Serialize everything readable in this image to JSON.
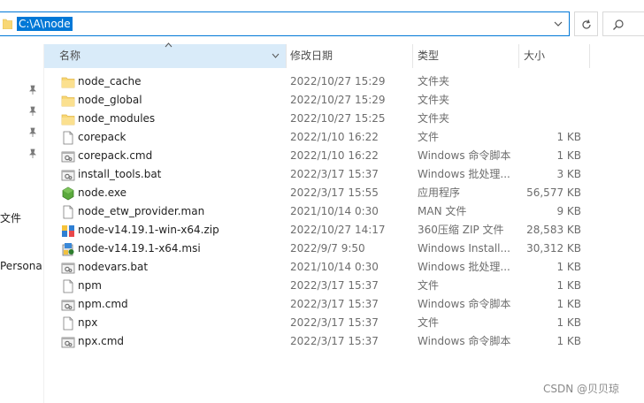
{
  "address": {
    "path": "C:\\A\\node"
  },
  "nav": {
    "partial_labels": [
      "文件",
      "Persona"
    ]
  },
  "columns": {
    "name": "名称",
    "date": "修改日期",
    "type": "类型",
    "size": "大小"
  },
  "files": [
    {
      "name": "node_cache",
      "date": "2022/10/27 15:29",
      "type": "文件夹",
      "size": "",
      "icon": "folder-icon"
    },
    {
      "name": "node_global",
      "date": "2022/10/27 15:29",
      "type": "文件夹",
      "size": "",
      "icon": "folder-icon"
    },
    {
      "name": "node_modules",
      "date": "2022/10/27 15:25",
      "type": "文件夹",
      "size": "",
      "icon": "folder-icon"
    },
    {
      "name": "corepack",
      "date": "2022/1/10 16:22",
      "type": "文件",
      "size": "1 KB",
      "icon": "file-icon"
    },
    {
      "name": "corepack.cmd",
      "date": "2022/1/10 16:22",
      "type": "Windows 命令脚本",
      "size": "1 KB",
      "icon": "script-icon"
    },
    {
      "name": "install_tools.bat",
      "date": "2022/3/17 15:37",
      "type": "Windows 批处理...",
      "size": "3 KB",
      "icon": "script-icon"
    },
    {
      "name": "node.exe",
      "date": "2022/3/17 15:55",
      "type": "应用程序",
      "size": "56,577 KB",
      "icon": "node-exe-icon"
    },
    {
      "name": "node_etw_provider.man",
      "date": "2021/10/14 0:30",
      "type": "MAN 文件",
      "size": "9 KB",
      "icon": "file-icon"
    },
    {
      "name": "node-v14.19.1-win-x64.zip",
      "date": "2022/10/27 14:17",
      "type": "360压缩 ZIP 文件",
      "size": "28,583 KB",
      "icon": "zip-icon"
    },
    {
      "name": "node-v14.19.1-x64.msi",
      "date": "2022/9/7 9:50",
      "type": "Windows Install...",
      "size": "30,312 KB",
      "icon": "msi-icon"
    },
    {
      "name": "nodevars.bat",
      "date": "2021/10/14 0:30",
      "type": "Windows 批处理...",
      "size": "1 KB",
      "icon": "script-icon"
    },
    {
      "name": "npm",
      "date": "2022/3/17 15:37",
      "type": "文件",
      "size": "1 KB",
      "icon": "file-icon"
    },
    {
      "name": "npm.cmd",
      "date": "2022/3/17 15:37",
      "type": "Windows 命令脚本",
      "size": "1 KB",
      "icon": "script-icon"
    },
    {
      "name": "npx",
      "date": "2022/3/17 15:37",
      "type": "文件",
      "size": "1 KB",
      "icon": "file-icon"
    },
    {
      "name": "npx.cmd",
      "date": "2022/3/17 15:37",
      "type": "Windows 命令脚本",
      "size": "1 KB",
      "icon": "script-icon"
    }
  ],
  "watermark": "CSDN @贝贝琼",
  "colors": {
    "accent": "#0078d7",
    "header_selected": "#d9ebf9",
    "folder": "#f8d775"
  }
}
